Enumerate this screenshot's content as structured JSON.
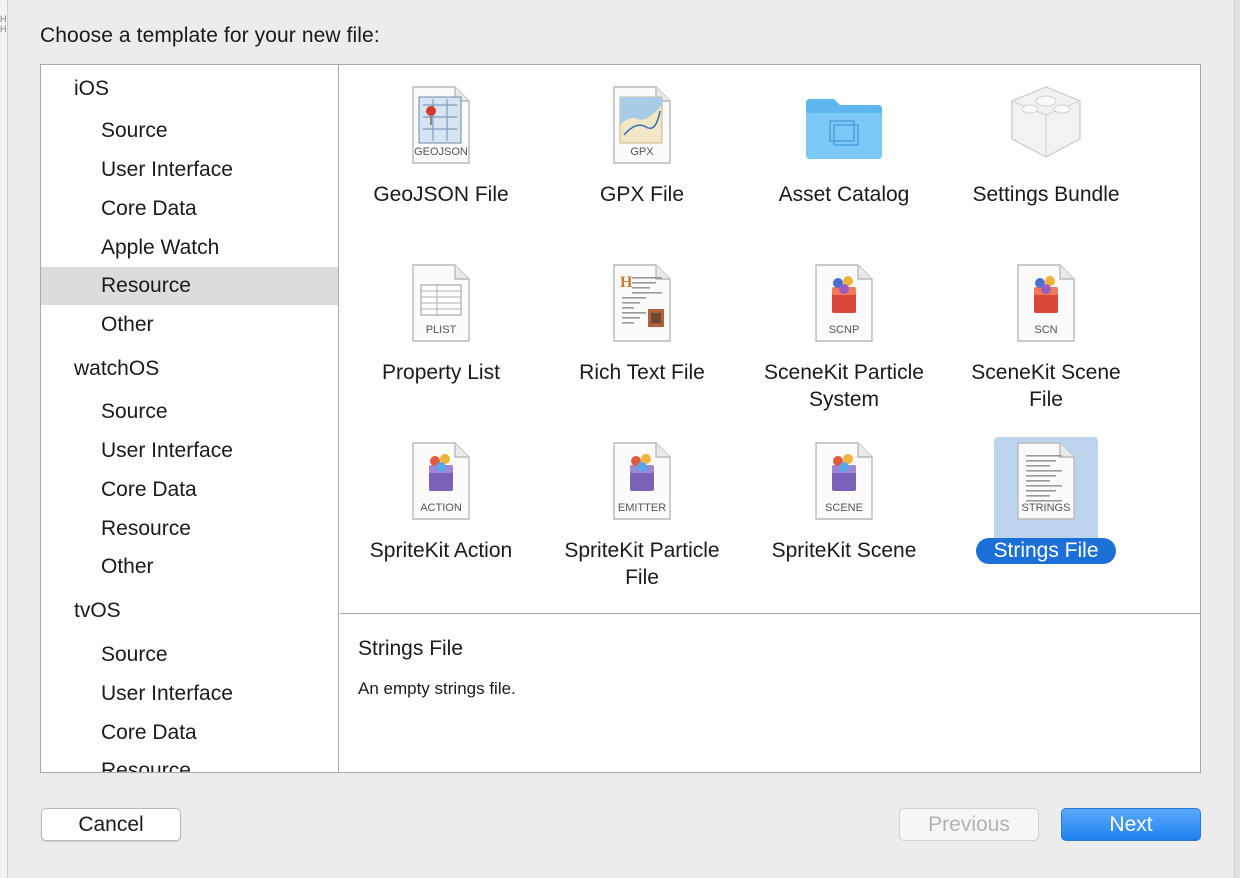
{
  "dialog": {
    "title": "Choose a template for your new file:"
  },
  "sidebar": {
    "items": [
      {
        "label": "iOS",
        "kind": "head"
      },
      {
        "label": "Source",
        "kind": "child"
      },
      {
        "label": "User Interface",
        "kind": "child"
      },
      {
        "label": "Core Data",
        "kind": "child"
      },
      {
        "label": "Apple Watch",
        "kind": "child"
      },
      {
        "label": "Resource",
        "kind": "child",
        "selected": true
      },
      {
        "label": "Other",
        "kind": "child"
      },
      {
        "label": "watchOS",
        "kind": "head"
      },
      {
        "label": "Source",
        "kind": "child"
      },
      {
        "label": "User Interface",
        "kind": "child"
      },
      {
        "label": "Core Data",
        "kind": "child"
      },
      {
        "label": "Resource",
        "kind": "child"
      },
      {
        "label": "Other",
        "kind": "child"
      },
      {
        "label": "tvOS",
        "kind": "head"
      },
      {
        "label": "Source",
        "kind": "child"
      },
      {
        "label": "User Interface",
        "kind": "child"
      },
      {
        "label": "Core Data",
        "kind": "child"
      },
      {
        "label": "Resource",
        "kind": "child"
      }
    ]
  },
  "templates": [
    {
      "label": "GeoJSON File",
      "icon": "geojson-file-icon",
      "badge": "GEOJSON"
    },
    {
      "label": "GPX File",
      "icon": "gpx-file-icon",
      "badge": "GPX"
    },
    {
      "label": "Asset Catalog",
      "icon": "folder-icon",
      "badge": ""
    },
    {
      "label": "Settings Bundle",
      "icon": "settings-bundle-icon",
      "badge": ""
    },
    {
      "label": "Property List",
      "icon": "plist-file-icon",
      "badge": "PLIST"
    },
    {
      "label": "Rich Text File",
      "icon": "rich-text-file-icon",
      "badge": ""
    },
    {
      "label": "SceneKit Particle System",
      "icon": "scenekit-particle-icon",
      "badge": "SCNP"
    },
    {
      "label": "SceneKit Scene File",
      "icon": "scenekit-scene-icon",
      "badge": "SCN"
    },
    {
      "label": "SpriteKit Action",
      "icon": "spritekit-action-icon",
      "badge": "ACTION"
    },
    {
      "label": "SpriteKit Particle File",
      "icon": "spritekit-emitter-icon",
      "badge": "EMITTER"
    },
    {
      "label": "SpriteKit Scene",
      "icon": "spritekit-scene-icon",
      "badge": "SCENE"
    },
    {
      "label": "Strings File",
      "icon": "strings-file-icon",
      "badge": "STRINGS",
      "selected": true
    }
  ],
  "description": {
    "title": "Strings File",
    "text": "An empty strings file."
  },
  "buttons": {
    "cancel": "Cancel",
    "previous": "Previous",
    "next": "Next"
  },
  "colors": {
    "selection_blue": "#1b6fd6",
    "selection_tile": "#bdd4ee",
    "sidebar_selected": "#dcdcdc"
  }
}
